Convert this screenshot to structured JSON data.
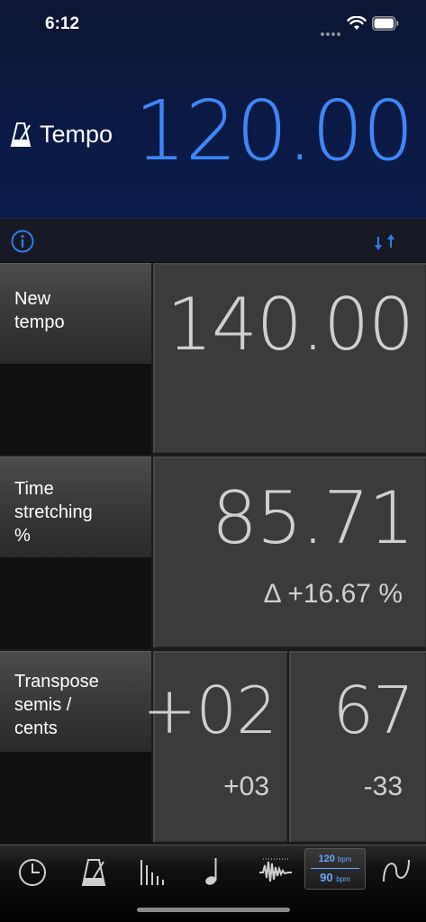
{
  "status_bar": {
    "time": "6:12"
  },
  "tempo": {
    "label": "Tempo",
    "value": "120.00"
  },
  "rows": {
    "new_tempo": {
      "label_line1": "New",
      "label_line2": "tempo",
      "value": "140.00"
    },
    "time_stretching": {
      "label_line1": "Time",
      "label_line2": "stretching",
      "label_line3": "%",
      "value": "85.71",
      "delta": "Δ +16.67 %"
    },
    "transpose": {
      "label_line1": "Transpose",
      "label_line2": "semis /",
      "label_line3": "cents",
      "semis": "+02",
      "semis_sub": "+03",
      "cents": "67",
      "cents_sub": "-33"
    }
  },
  "toolbar": {
    "items": [
      "clock-icon",
      "metronome-icon",
      "bars-icon",
      "note-icon",
      "waveform-icon",
      "tempo-converter",
      "sine-wave-icon"
    ],
    "selected_top": "120",
    "selected_top_unit": "bpm",
    "selected_bottom": "90",
    "selected_bottom_unit": "bpm"
  },
  "colors": {
    "accent": "#3f86f6",
    "header_bg": "#0b1a44",
    "cell_bg": "#3b3b3b"
  }
}
